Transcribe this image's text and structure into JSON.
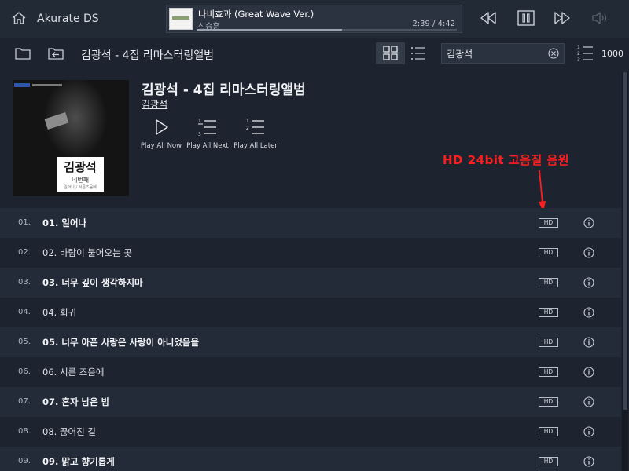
{
  "app": {
    "title": "Akurate DS"
  },
  "now_playing": {
    "title": "나비효과 (Great Wave Ver.)",
    "artist": "신승훈",
    "time": "2:39 / 4:42",
    "progress": 0.56
  },
  "transport": {
    "icons": [
      "previous-icon",
      "pause-icon",
      "next-icon",
      "volume-icon"
    ]
  },
  "toolbar": {
    "album_title": "김광석 - 4집 리마스터링앨범",
    "search_value": "김광석",
    "count": "1000"
  },
  "album": {
    "title": "김광석 - 4집 리마스터링앨범",
    "artist": "김광석",
    "art_text_main": "김광석",
    "art_text_sub": "네번째",
    "art_text_small": "일어나 / 서른즈음에"
  },
  "actions": [
    {
      "label": "Play All Now",
      "icon": "play-icon"
    },
    {
      "label": "Play All Next",
      "icon": "queue-next-icon"
    },
    {
      "label": "Play All Later",
      "icon": "queue-later-icon"
    }
  ],
  "annotation": {
    "text": "HD 24bit 고음질 음원",
    "color": "#ff1e1e"
  },
  "tracks": [
    {
      "num": "01.",
      "title": "01. 일어나",
      "badge": "HD"
    },
    {
      "num": "02.",
      "title": "02. 바람이 불어오는 곳",
      "badge": "HD"
    },
    {
      "num": "03.",
      "title": "03. 너무 깊이 생각하지마",
      "badge": "HD"
    },
    {
      "num": "04.",
      "title": "04. 회귀",
      "badge": "HD"
    },
    {
      "num": "05.",
      "title": "05. 너무 아픈 사랑은 사랑이 아니었음을",
      "badge": "HD"
    },
    {
      "num": "06.",
      "title": "06. 서른 즈음에",
      "badge": "HD"
    },
    {
      "num": "07.",
      "title": "07. 혼자 남은 밤",
      "badge": "HD"
    },
    {
      "num": "08.",
      "title": "08. 끊어진 길",
      "badge": "HD"
    },
    {
      "num": "09.",
      "title": "09. 맑고 향기롭게",
      "badge": "HD"
    }
  ],
  "colors": {
    "background": "#1d2430",
    "row_dark": "#232b38",
    "accent": "#ff1e1e"
  }
}
